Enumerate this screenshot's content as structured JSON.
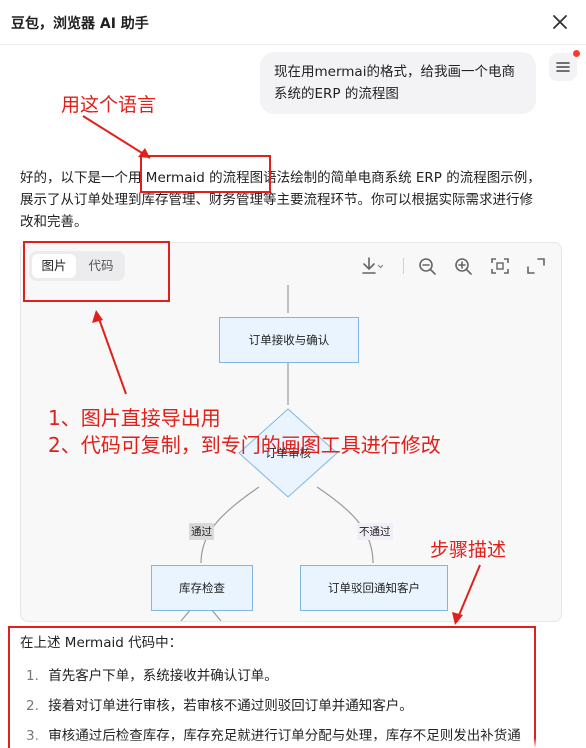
{
  "window": {
    "title": "豆包，浏览器 AI 助手"
  },
  "user_message": {
    "line1": "现在用mermai的格式，给我画一个电商",
    "line2": "系统的ERP 的流程图"
  },
  "annotations": {
    "language": "用这个语言",
    "note1": "1、图片直接导出用",
    "note2": "2、代码可复制，到专门的画图工具进行修改",
    "steps": "步骤描述",
    "color": "#e0201b"
  },
  "reply": {
    "line1": "好的，以下是一个用 Mermaid 的流程图语法绘制的简单电商系统 ERP 的流程图示例，",
    "line2": "展示了从订单处理到库存管理、财务管理等主要流程环节。你可以根据实际需求进行修",
    "line3": "改和完善。"
  },
  "diagram": {
    "tabs": [
      "图片",
      "代码"
    ],
    "active_tab": "图片",
    "toolbar_icons": [
      "download-icon",
      "chevron-down-icon",
      "zoom-out-icon",
      "zoom-in-icon",
      "fit-screen-icon",
      "fullscreen-icon"
    ],
    "nodes": {
      "n1": "订单接收与确认",
      "n2": "订单审核",
      "n3": "库存检查",
      "n4": "订单驳回通知客户"
    },
    "edges": {
      "pass": "通过",
      "fail": "不通过"
    },
    "colors": {
      "node_fill": "#e9f4ff",
      "node_border": "#7fb6e2",
      "edge": "#9a9a9a"
    }
  },
  "notes": {
    "heading": "在上述 Mermaid 代码中：",
    "items": [
      "首先客户下单，系统接收并确认订单。",
      "接着对订单进行审核，若审核不通过则驳回订单并通知客户。",
      "审核通过后检查库存，库存充足就进行订单分配与处理，库存不足则发出补货通"
    ],
    "numbers": [
      "1.",
      "2.",
      "3."
    ]
  }
}
